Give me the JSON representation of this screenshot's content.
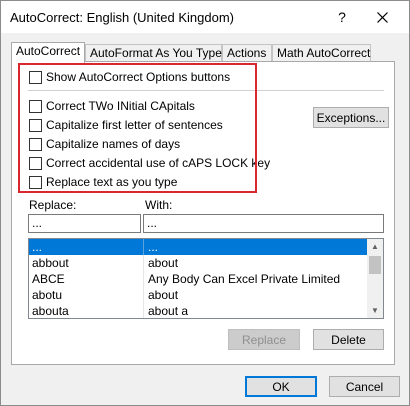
{
  "window": {
    "title": "AutoCorrect: English (United Kingdom)",
    "help_glyph": "?"
  },
  "tabs": [
    {
      "label": "AutoCorrect",
      "active": true
    },
    {
      "label": "AutoFormat As You Type",
      "active": false
    },
    {
      "label": "Actions",
      "active": false
    },
    {
      "label": "Math AutoCorrect",
      "active": false
    }
  ],
  "options": {
    "show_buttons": {
      "label": "Show AutoCorrect Options buttons",
      "checked": false
    },
    "correct_two_initial": {
      "label": "Correct TWo INitial CApitals",
      "checked": false
    },
    "capitalize_sentences": {
      "label": "Capitalize first letter of sentences",
      "checked": false
    },
    "capitalize_days": {
      "label": "Capitalize names of days",
      "checked": false
    },
    "caps_lock": {
      "label": "Correct accidental use of cAPS LOCK key",
      "checked": false
    },
    "replace_text": {
      "label": "Replace text as you type",
      "checked": false
    }
  },
  "exceptions_button": "Exceptions...",
  "replace": {
    "label": "Replace:",
    "value": "..."
  },
  "with": {
    "label": "With:",
    "value": "..."
  },
  "list": {
    "rows": [
      {
        "replace": "...",
        "with": "...",
        "selected": true
      },
      {
        "replace": "abbout",
        "with": "about",
        "selected": false
      },
      {
        "replace": "ABCE",
        "with": "Any Body Can Excel Private Limited",
        "selected": false
      },
      {
        "replace": "abotu",
        "with": "about",
        "selected": false
      },
      {
        "replace": "abouta",
        "with": "about a",
        "selected": false
      }
    ]
  },
  "buttons": {
    "replace": "Replace",
    "delete": "Delete",
    "ok": "OK",
    "cancel": "Cancel"
  },
  "colors": {
    "highlight_border": "#d9262f",
    "selection": "#0078d7"
  }
}
